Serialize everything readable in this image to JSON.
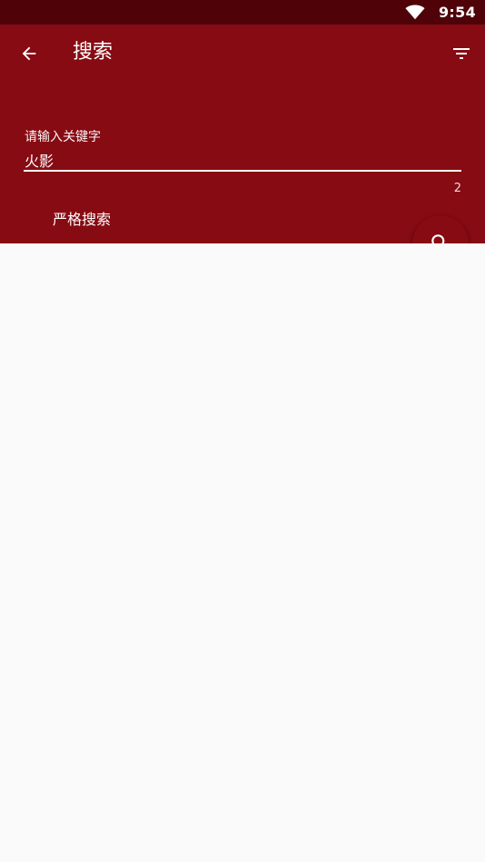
{
  "status_bar": {
    "time": "9:54",
    "wifi_icon": "wifi-icon"
  },
  "app_bar": {
    "title": "搜索",
    "back_icon": "arrow-back-icon",
    "filter_icon": "filter-icon",
    "background_color": "#870b13"
  },
  "search": {
    "label": "请输入关键字",
    "value": "火影",
    "char_count": "2"
  },
  "options": {
    "strict_search_label": "严格搜索"
  },
  "fab": {
    "icon": "search-icon"
  }
}
